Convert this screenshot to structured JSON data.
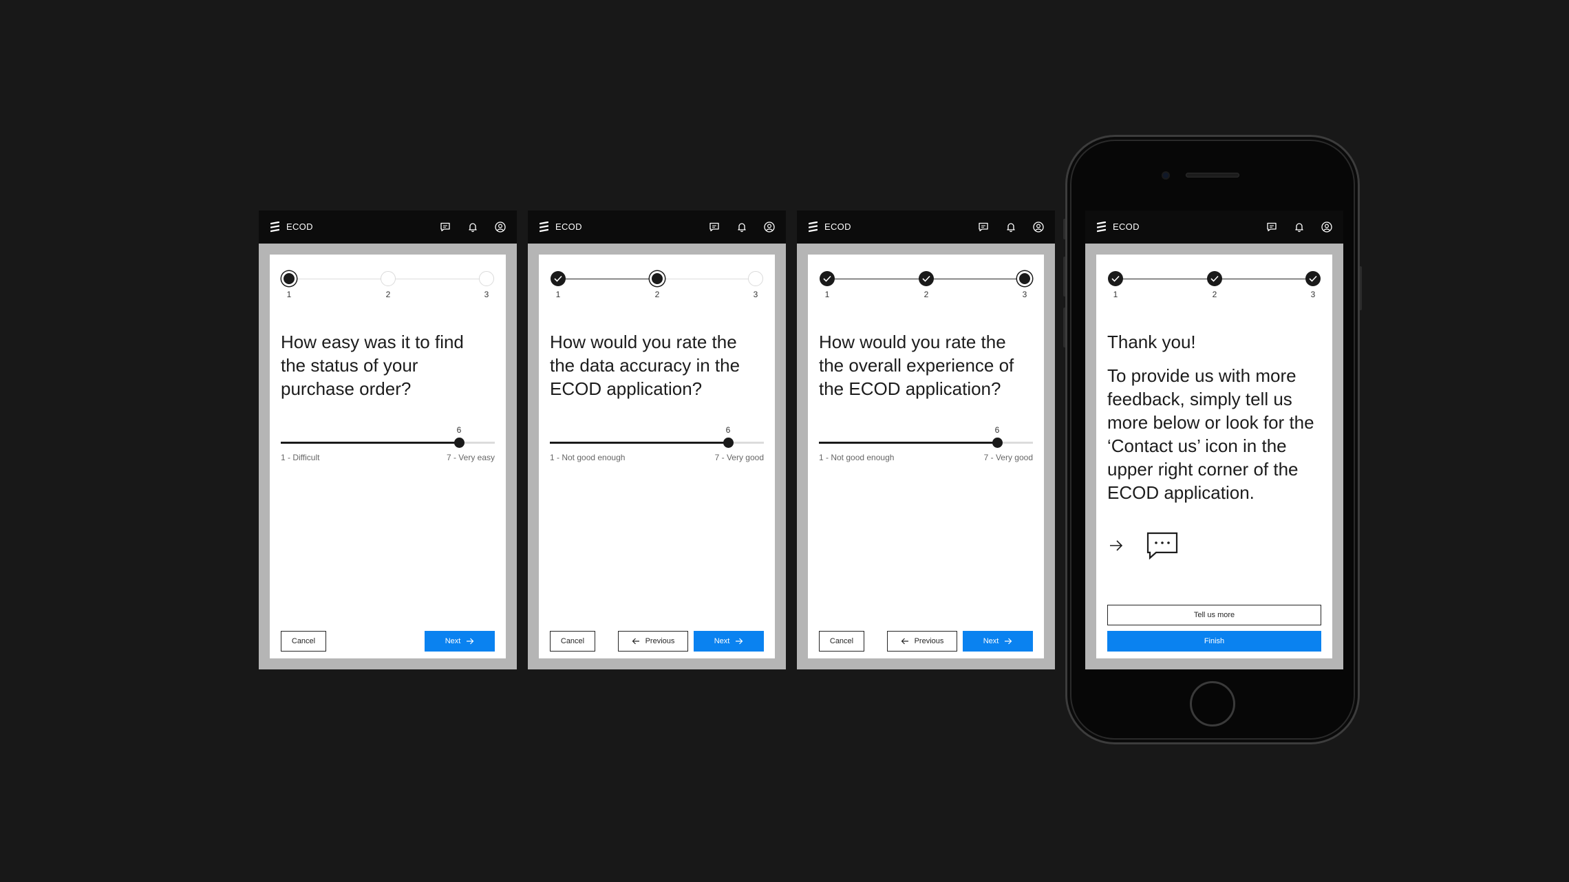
{
  "app": {
    "name": "ECOD",
    "icons": [
      "ecod-logo-icon",
      "chat-icon",
      "bell-icon",
      "user-icon",
      "check-icon",
      "arrow-right-icon",
      "arrow-left-icon",
      "chat-bubble-icon"
    ]
  },
  "screens": [
    {
      "stepper": {
        "steps": [
          "1",
          "2",
          "3"
        ],
        "current": 1
      },
      "question": "How easy was it to find the status of your purchase order?",
      "slider": {
        "min": 1,
        "max": 7,
        "value": 6,
        "value_label": "6",
        "min_label": "1 - Difficult",
        "max_label": "7 - Very easy"
      },
      "buttons": {
        "cancel": "Cancel",
        "next": "Next"
      }
    },
    {
      "stepper": {
        "steps": [
          "1",
          "2",
          "3"
        ],
        "current": 2
      },
      "question": "How would you rate the the data accuracy in the ECOD application?",
      "slider": {
        "min": 1,
        "max": 7,
        "value": 6,
        "value_label": "6",
        "min_label": "1 - Not good enough",
        "max_label": "7 - Very good"
      },
      "buttons": {
        "cancel": "Cancel",
        "previous": "Previous",
        "next": "Next"
      }
    },
    {
      "stepper": {
        "steps": [
          "1",
          "2",
          "3"
        ],
        "current": 3
      },
      "question": "How would you rate the the overall experience of the ECOD application?",
      "slider": {
        "min": 1,
        "max": 7,
        "value": 6,
        "value_label": "6",
        "min_label": "1 - Not good enough",
        "max_label": "7 - Very good"
      },
      "buttons": {
        "cancel": "Cancel",
        "previous": "Previous",
        "next": "Next"
      }
    },
    {
      "stepper": {
        "steps": [
          "1",
          "2",
          "3"
        ],
        "current": 4
      },
      "thanks_title": "Thank you!",
      "thanks_body": "To provide us with more feedback, simply tell us more below or look for the ‘Contact us’ icon in the upper right corner of the ECOD application.",
      "buttons": {
        "tell_more": "Tell us more",
        "finish": "Finish"
      }
    }
  ],
  "colors": {
    "primary": "#0a82f0",
    "background": "#181818",
    "topbar": "#0c0c0c",
    "screen_bg": "#b5b5b5"
  }
}
